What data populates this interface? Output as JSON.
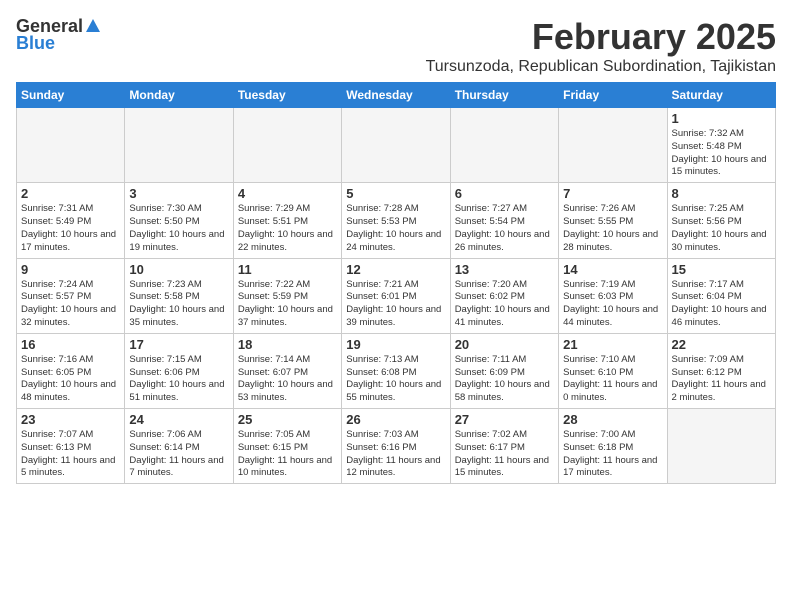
{
  "header": {
    "logo_general": "General",
    "logo_blue": "Blue",
    "month": "February 2025",
    "location": "Tursunzoda, Republican Subordination, Tajikistan"
  },
  "weekdays": [
    "Sunday",
    "Monday",
    "Tuesday",
    "Wednesday",
    "Thursday",
    "Friday",
    "Saturday"
  ],
  "weeks": [
    [
      {
        "day": "",
        "info": ""
      },
      {
        "day": "",
        "info": ""
      },
      {
        "day": "",
        "info": ""
      },
      {
        "day": "",
        "info": ""
      },
      {
        "day": "",
        "info": ""
      },
      {
        "day": "",
        "info": ""
      },
      {
        "day": "1",
        "info": "Sunrise: 7:32 AM\nSunset: 5:48 PM\nDaylight: 10 hours and 15 minutes."
      }
    ],
    [
      {
        "day": "2",
        "info": "Sunrise: 7:31 AM\nSunset: 5:49 PM\nDaylight: 10 hours and 17 minutes."
      },
      {
        "day": "3",
        "info": "Sunrise: 7:30 AM\nSunset: 5:50 PM\nDaylight: 10 hours and 19 minutes."
      },
      {
        "day": "4",
        "info": "Sunrise: 7:29 AM\nSunset: 5:51 PM\nDaylight: 10 hours and 22 minutes."
      },
      {
        "day": "5",
        "info": "Sunrise: 7:28 AM\nSunset: 5:53 PM\nDaylight: 10 hours and 24 minutes."
      },
      {
        "day": "6",
        "info": "Sunrise: 7:27 AM\nSunset: 5:54 PM\nDaylight: 10 hours and 26 minutes."
      },
      {
        "day": "7",
        "info": "Sunrise: 7:26 AM\nSunset: 5:55 PM\nDaylight: 10 hours and 28 minutes."
      },
      {
        "day": "8",
        "info": "Sunrise: 7:25 AM\nSunset: 5:56 PM\nDaylight: 10 hours and 30 minutes."
      }
    ],
    [
      {
        "day": "9",
        "info": "Sunrise: 7:24 AM\nSunset: 5:57 PM\nDaylight: 10 hours and 32 minutes."
      },
      {
        "day": "10",
        "info": "Sunrise: 7:23 AM\nSunset: 5:58 PM\nDaylight: 10 hours and 35 minutes."
      },
      {
        "day": "11",
        "info": "Sunrise: 7:22 AM\nSunset: 5:59 PM\nDaylight: 10 hours and 37 minutes."
      },
      {
        "day": "12",
        "info": "Sunrise: 7:21 AM\nSunset: 6:01 PM\nDaylight: 10 hours and 39 minutes."
      },
      {
        "day": "13",
        "info": "Sunrise: 7:20 AM\nSunset: 6:02 PM\nDaylight: 10 hours and 41 minutes."
      },
      {
        "day": "14",
        "info": "Sunrise: 7:19 AM\nSunset: 6:03 PM\nDaylight: 10 hours and 44 minutes."
      },
      {
        "day": "15",
        "info": "Sunrise: 7:17 AM\nSunset: 6:04 PM\nDaylight: 10 hours and 46 minutes."
      }
    ],
    [
      {
        "day": "16",
        "info": "Sunrise: 7:16 AM\nSunset: 6:05 PM\nDaylight: 10 hours and 48 minutes."
      },
      {
        "day": "17",
        "info": "Sunrise: 7:15 AM\nSunset: 6:06 PM\nDaylight: 10 hours and 51 minutes."
      },
      {
        "day": "18",
        "info": "Sunrise: 7:14 AM\nSunset: 6:07 PM\nDaylight: 10 hours and 53 minutes."
      },
      {
        "day": "19",
        "info": "Sunrise: 7:13 AM\nSunset: 6:08 PM\nDaylight: 10 hours and 55 minutes."
      },
      {
        "day": "20",
        "info": "Sunrise: 7:11 AM\nSunset: 6:09 PM\nDaylight: 10 hours and 58 minutes."
      },
      {
        "day": "21",
        "info": "Sunrise: 7:10 AM\nSunset: 6:10 PM\nDaylight: 11 hours and 0 minutes."
      },
      {
        "day": "22",
        "info": "Sunrise: 7:09 AM\nSunset: 6:12 PM\nDaylight: 11 hours and 2 minutes."
      }
    ],
    [
      {
        "day": "23",
        "info": "Sunrise: 7:07 AM\nSunset: 6:13 PM\nDaylight: 11 hours and 5 minutes."
      },
      {
        "day": "24",
        "info": "Sunrise: 7:06 AM\nSunset: 6:14 PM\nDaylight: 11 hours and 7 minutes."
      },
      {
        "day": "25",
        "info": "Sunrise: 7:05 AM\nSunset: 6:15 PM\nDaylight: 11 hours and 10 minutes."
      },
      {
        "day": "26",
        "info": "Sunrise: 7:03 AM\nSunset: 6:16 PM\nDaylight: 11 hours and 12 minutes."
      },
      {
        "day": "27",
        "info": "Sunrise: 7:02 AM\nSunset: 6:17 PM\nDaylight: 11 hours and 15 minutes."
      },
      {
        "day": "28",
        "info": "Sunrise: 7:00 AM\nSunset: 6:18 PM\nDaylight: 11 hours and 17 minutes."
      },
      {
        "day": "",
        "info": ""
      }
    ]
  ]
}
